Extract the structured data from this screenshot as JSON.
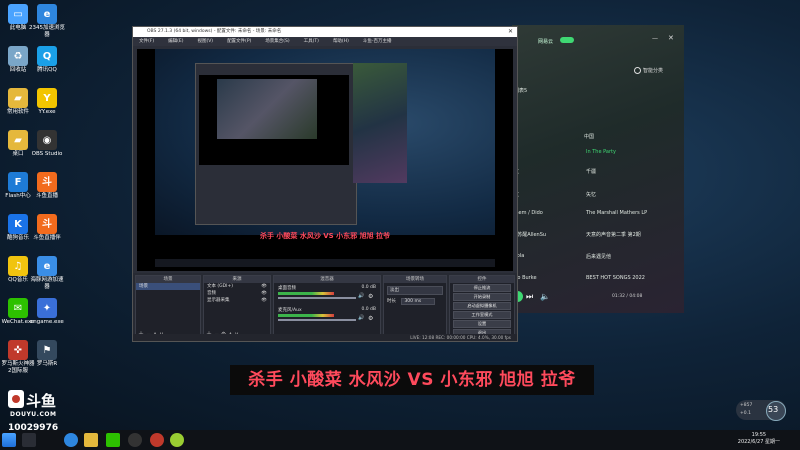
{
  "desktop": {
    "icons": [
      {
        "label": "此电脑",
        "name": "this-pc-icon",
        "color": "#4aa3ff",
        "glyph": "▭"
      },
      {
        "label": "2345加速浏览器",
        "name": "browser-2345-icon",
        "color": "#2e86de",
        "glyph": "e"
      },
      {
        "label": "回收站",
        "name": "recycle-bin-icon",
        "color": "#7aa6c8",
        "glyph": "♻"
      },
      {
        "label": "腾讯QQ",
        "name": "tencent-qq-icon",
        "color": "#1aa0e8",
        "glyph": "Q"
      },
      {
        "label": "常用软件",
        "name": "common-software-icon",
        "color": "#e5b83c",
        "glyph": "▰"
      },
      {
        "label": "YY.exe",
        "name": "yy-icon",
        "color": "#f2c500",
        "glyph": "Y"
      },
      {
        "label": "桌口",
        "name": "desktop-folder-icon",
        "color": "#e5b83c",
        "glyph": "▰"
      },
      {
        "label": "OBS Studio",
        "name": "obs-studio-icon",
        "color": "#333333",
        "glyph": "◉"
      },
      {
        "label": "Flash中心",
        "name": "flash-center-icon",
        "color": "#1e7bd6",
        "glyph": "F"
      },
      {
        "label": "斗鱼直播",
        "name": "douyu-live-icon",
        "color": "#f26b1d",
        "glyph": "斗"
      },
      {
        "label": "酷狗音乐",
        "name": "kugou-music-icon",
        "color": "#1a73e8",
        "glyph": "K"
      },
      {
        "label": "斗鱼直播伴",
        "name": "douyu-companion-icon",
        "color": "#f26b1d",
        "glyph": "斗"
      },
      {
        "label": "QQ音乐",
        "name": "qq-music-icon",
        "color": "#f1c40f",
        "glyph": "♫"
      },
      {
        "label": "海豚网游加速器",
        "name": "dolphin-accelerator-icon",
        "color": "#3a8ee6",
        "glyph": "e"
      },
      {
        "label": "WeChat.exe",
        "name": "wechat-icon",
        "color": "#2dc100",
        "glyph": "✉"
      },
      {
        "label": "cngame.exe",
        "name": "cngame-icon",
        "color": "#3a6fd8",
        "glyph": "✦"
      },
      {
        "label": "罗马斯火神器2国际服",
        "name": "game-launcher-icon",
        "color": "#c0392b",
        "glyph": "✜"
      },
      {
        "label": "罗马斯R",
        "name": "game-r-icon",
        "color": "#34495e",
        "glyph": "⚑"
      }
    ]
  },
  "music_player": {
    "search_hint": "网易云",
    "smart_sort": "智能分类",
    "rows": [
      {
        "text": "列表5",
        "green": false
      },
      {
        "text": "中国",
        "green": false
      },
      {
        "text": "In The Party",
        "green": true
      },
      {
        "text": "千疆",
        "green": false
      },
      {
        "text": "矢忆",
        "green": false
      },
      {
        "text": "The Marshall Mathers LP",
        "green": false
      },
      {
        "text": "天意的声音第二季 第2期",
        "green": false
      },
      {
        "text": "后来遇见他",
        "green": false
      },
      {
        "text": "BEST HOT SONGS 2022",
        "green": false
      }
    ],
    "left_rows": [
      "文",
      "文",
      "inem / Dido",
      "/ 苏醒AllenSu",
      "cola",
      "Bo Burke"
    ],
    "time": "01:32 / 04:08",
    "colors": {
      "accent": "#3fd873"
    }
  },
  "obs": {
    "title": "OBS 27.1.3 (64 bit, windows) - 配置文件: 未命名 - 场景: 未命名",
    "menu": [
      "文件(F)",
      "编辑(E)",
      "视图(V)",
      "配置文件(P)",
      "场景集合(S)",
      "工具(T)",
      "帮助(H)",
      "斗鱼-百万主播"
    ],
    "preview_caption": "杀手 小酸菜 水风沙 VS 小东邪 旭旭 拉爷",
    "scenes_title": "场景",
    "scene_items": [
      "场景"
    ],
    "sources_title": "来源",
    "source_items": [
      "文本 (GDI+)",
      "音频",
      "显示器采集"
    ],
    "mixer_title": "混音器",
    "mixer_tracks": [
      {
        "name": "桌面音频",
        "db": "0.0 dB"
      },
      {
        "name": "麦克风/Aux",
        "db": "0.0 dB"
      }
    ],
    "transitions_title": "场景转场",
    "transition_type": "淡出",
    "duration_label": "时长",
    "duration_value": "300 ms",
    "controls_title": "控件",
    "controls": [
      "停止推流",
      "开始录制",
      "启动虚拟摄像机",
      "工作室模式",
      "设置",
      "退出"
    ],
    "status": "LIVE: 12:08  REC: 00:00:00  CPU: 4.0%, 30.00 fps",
    "colors": {
      "panel": "#2b2e38",
      "live": "#3cb44b"
    }
  },
  "caption": {
    "text": "杀手 小酸菜 水风沙 VS 小东邪 旭旭 拉爷",
    "color": "#ff4a5c"
  },
  "stream": {
    "logo_text": "斗鱼",
    "logo_sub": "DOUYU.COM",
    "room_id": "10029976",
    "fps_value": "53",
    "net_up": "+857",
    "net_down": "+0.1"
  },
  "taskbar": {
    "time": "19:55",
    "date": "2022/6/27 星期一"
  }
}
